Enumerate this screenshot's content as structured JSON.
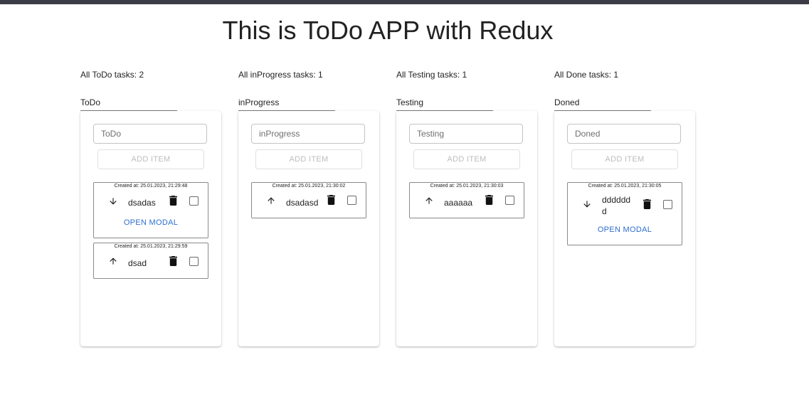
{
  "app": {
    "title": "This is ToDo APP with Redux"
  },
  "add_label": "ADD ITEM",
  "modal_label": "OPEN MODAL",
  "columns": [
    {
      "count_text": "All ToDo tasks: 2",
      "name": "ToDo",
      "placeholder": "ToDo",
      "tasks": [
        {
          "created": "Created at: 25.01.2023, 21:29:48",
          "text": "dsadas",
          "arrow": "arrow-down-icon"
        },
        {
          "created": "Created at: 25.01.2023, 21:29:59",
          "text": "dsad",
          "arrow": "arrow-up-icon"
        }
      ]
    },
    {
      "count_text": "All inProgress tasks: 1",
      "name": "inProgress",
      "placeholder": "inProgress",
      "tasks": [
        {
          "created": "Created at: 25.01.2023, 21:30:02",
          "text": "dsadasd",
          "arrow": "arrow-up-icon"
        }
      ]
    },
    {
      "count_text": "All Testing tasks: 1",
      "name": "Testing",
      "placeholder": "Testing",
      "tasks": [
        {
          "created": "Created at: 25.01.2023, 21:30:03",
          "text": "aaaaaa",
          "arrow": "arrow-up-icon"
        }
      ]
    },
    {
      "count_text": "All Done tasks: 1",
      "name": "Doned",
      "placeholder": "Doned",
      "tasks": [
        {
          "created": "Created at: 25.01.2023, 21:30:05",
          "text_line1": "dddddd",
          "text_line2": "d",
          "arrow": "arrow-down-icon"
        }
      ]
    }
  ]
}
